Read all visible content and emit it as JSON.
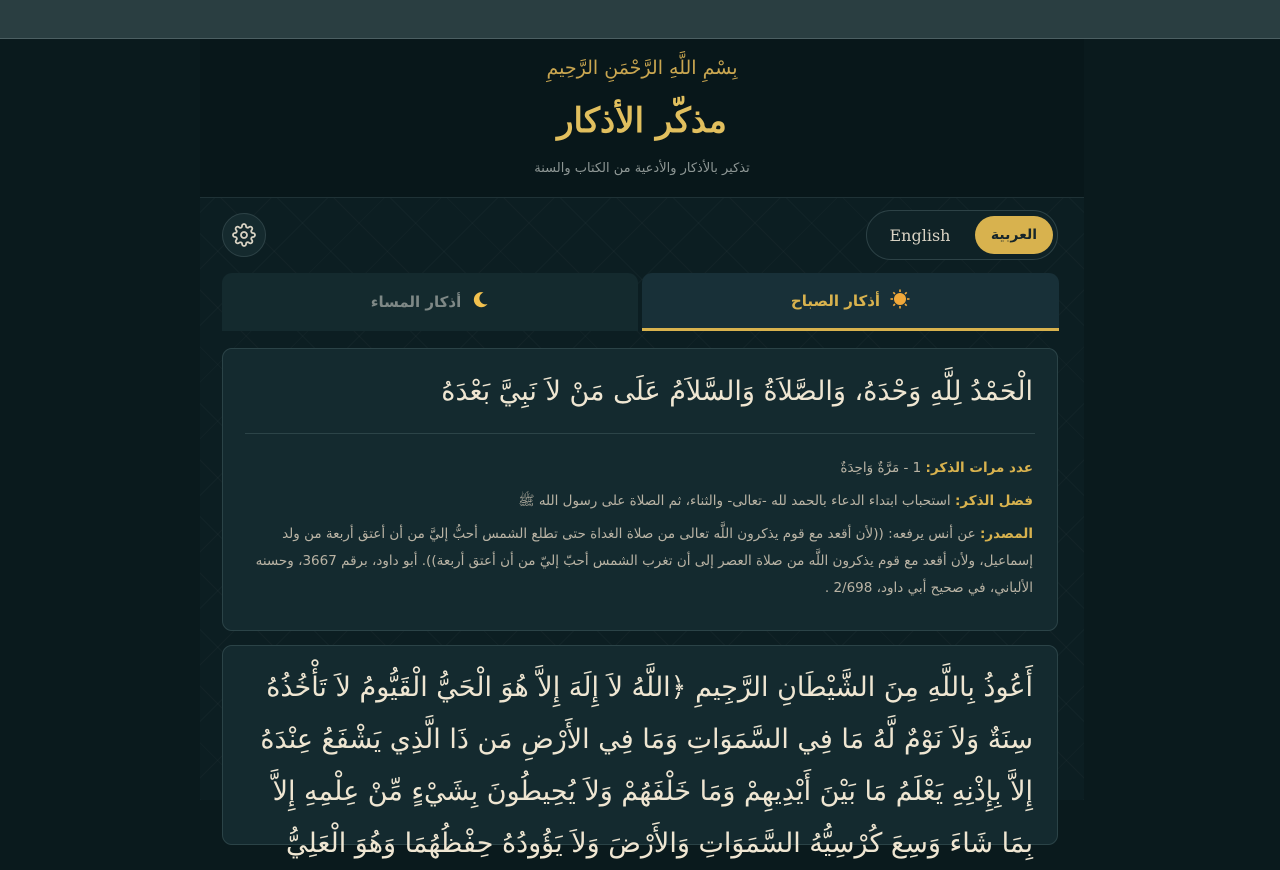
{
  "header": {
    "basmala": "بِسْمِ اللَّهِ الرَّحْمَنِ الرَّحِيمِ",
    "title": "مذكّر الأذكار",
    "subtitle": "تذكير بالأذكار والأدعية من الكتاب والسنة"
  },
  "language": {
    "english": "English",
    "arabic": "العربية",
    "selected": "العربية"
  },
  "settings": {
    "icon": "gear-icon"
  },
  "tabs": [
    {
      "label": "أذكار الصباح",
      "icon": "sun-icon",
      "active": true
    },
    {
      "label": "أذكار المساء",
      "icon": "moon-icon",
      "active": false
    }
  ],
  "adhkar": [
    {
      "text": "الْحَمْدُ لِلَّهِ وَحْدَهُ، وَالصَّلاَةُ وَالسَّلاَمُ عَلَى مَنْ لاَ نَبِيَّ بَعْدَهُ",
      "count_label": "عدد مرات الذكر:",
      "count_value": "1 - مَرَّةٌ وَاحِدَةٌ",
      "virtue_label": "فضل الذكر:",
      "virtue_value": "استحباب ابتداء الدعاء بالحمد لله -تعالى- والثناء، ثم الصلاة على رسول الله ﷺ",
      "source_label": "المصدر:",
      "source_value": "عن أنس يرفعه: ((لأن أقعد مع قوم يذكرون اللَّه تعالى من صلاة الغداة حتى تطلع الشمس أحبُّ إليَّ من أن أعتق أربعة من ولد إسماعيل، ولأن أقعد مع قوم يذكرون اللَّه من صلاة العصر إلى أن تغرب الشمس أحبّ إليّ من أن أعتق أربعة)). أبو داود، برقم 3667، وحسنه الألباني، في صحيح أبي داود، 2/698 ."
    },
    {
      "text": "أَعُوذُ بِاللَّهِ مِنَ الشَّيْطَانِ الرَّجِيمِ ﴿اللَّهُ لاَ إِلَهَ إِلاَّ هُوَ الْحَيُّ الْقَيُّومُ لاَ تَأْخُذُهُ سِنَةٌ وَلاَ نَوْمٌ لَّهُ مَا فِي السَّمَوَاتِ وَمَا فِي الأَرْضِ مَن ذَا الَّذِي يَشْفَعُ عِنْدَهُ إِلاَّ بِإِذْنِهِ يَعْلَمُ مَا بَيْنَ أَيْدِيهِمْ وَمَا خَلْفَهُمْ وَلاَ يُحِيطُونَ بِشَيْءٍ مِّنْ عِلْمِهِ إِلاَّ بِمَا شَاءَ وَسِعَ كُرْسِيُّهُ السَّمَوَاتِ وَالأَرْضَ وَلاَ يَؤُودُهُ حِفْظُهُمَا وَهُوَ الْعَلِيُّ"
    }
  ]
}
